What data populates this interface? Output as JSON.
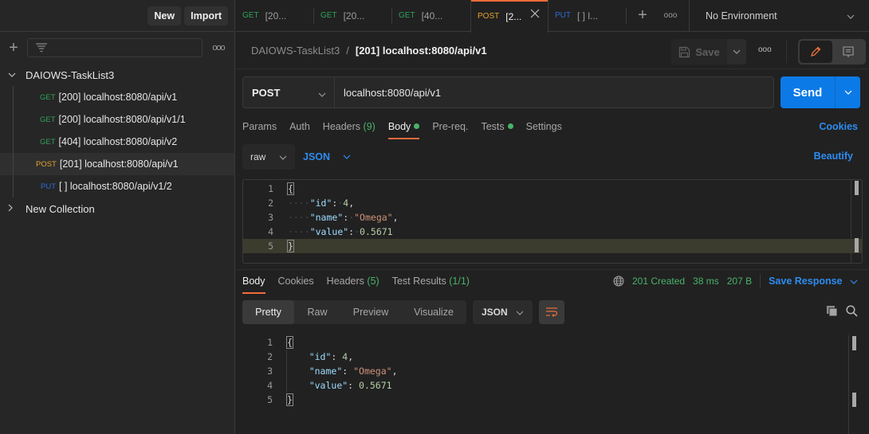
{
  "sidebar": {
    "new_label": "New",
    "import_label": "Import",
    "collections": [
      {
        "name": "DAIOWS-TaskList3",
        "expanded": true,
        "requests": [
          {
            "method": "GET",
            "label": "[200] localhost:8080/api/v1",
            "selected": false
          },
          {
            "method": "GET",
            "label": "[200] localhost:8080/api/v1/1",
            "selected": false
          },
          {
            "method": "GET",
            "label": "[404] localhost:8080/api/v2",
            "selected": false
          },
          {
            "method": "POST",
            "label": "[201] localhost:8080/api/v1",
            "selected": true
          },
          {
            "method": "PUT",
            "label": "[ ] localhost:8080/api/v1/2",
            "selected": false
          }
        ]
      },
      {
        "name": "New Collection",
        "expanded": false
      }
    ]
  },
  "tabs": [
    {
      "method": "GET",
      "label": "[20...",
      "active": false
    },
    {
      "method": "GET",
      "label": "[20...",
      "active": false
    },
    {
      "method": "GET",
      "label": "[40...",
      "active": false
    },
    {
      "method": "POST",
      "label": "[2...",
      "active": true
    },
    {
      "method": "PUT",
      "label": "[ ] l...",
      "active": false
    }
  ],
  "environment": "No Environment",
  "breadcrumb": {
    "collection": "DAIOWS-TaskList3",
    "separator": "/",
    "request": "[201] localhost:8080/api/v1"
  },
  "toolbar": {
    "save_label": "Save"
  },
  "request": {
    "method": "POST",
    "url": "localhost:8080/api/v1",
    "send_label": "Send",
    "tabs": [
      {
        "label": "Params"
      },
      {
        "label": "Auth"
      },
      {
        "label": "Headers",
        "count": "(9)"
      },
      {
        "label": "Body",
        "dot": true,
        "active": true
      },
      {
        "label": "Pre-req."
      },
      {
        "label": "Tests",
        "dot": true
      },
      {
        "label": "Settings"
      }
    ],
    "cookies_label": "Cookies",
    "body_mode": "raw",
    "body_lang": "JSON",
    "beautify_label": "Beautify",
    "body_lines": [
      "1",
      "2",
      "3",
      "4",
      "5"
    ]
  },
  "response": {
    "tabs": [
      {
        "label": "Body",
        "active": true
      },
      {
        "label": "Cookies"
      },
      {
        "label": "Headers",
        "count": "(5)"
      },
      {
        "label": "Test Results",
        "count": "(1/1)"
      }
    ],
    "status": "201 Created",
    "time": "38 ms",
    "size": "207 B",
    "save_label": "Save Response",
    "views": [
      "Pretty",
      "Raw",
      "Preview",
      "Visualize"
    ],
    "active_view": "Pretty",
    "format": "JSON"
  },
  "json_body": {
    "open": "{",
    "close": "}",
    "fields": [
      {
        "key": "\"id\"",
        "value": "4",
        "type": "number",
        "comma": ","
      },
      {
        "key": "\"name\"",
        "value": "\"Omega\"",
        "type": "string",
        "comma": ","
      },
      {
        "key": "\"value\"",
        "value": "0.5671",
        "type": "number",
        "comma": ""
      }
    ]
  },
  "colors": {
    "accent": "#f26b3a",
    "send": "#0c7ae6",
    "link": "#2d8cf0",
    "success": "#49b36a",
    "get": "#2fa15a",
    "post": "#e3a12f",
    "put": "#2b6dd8"
  }
}
